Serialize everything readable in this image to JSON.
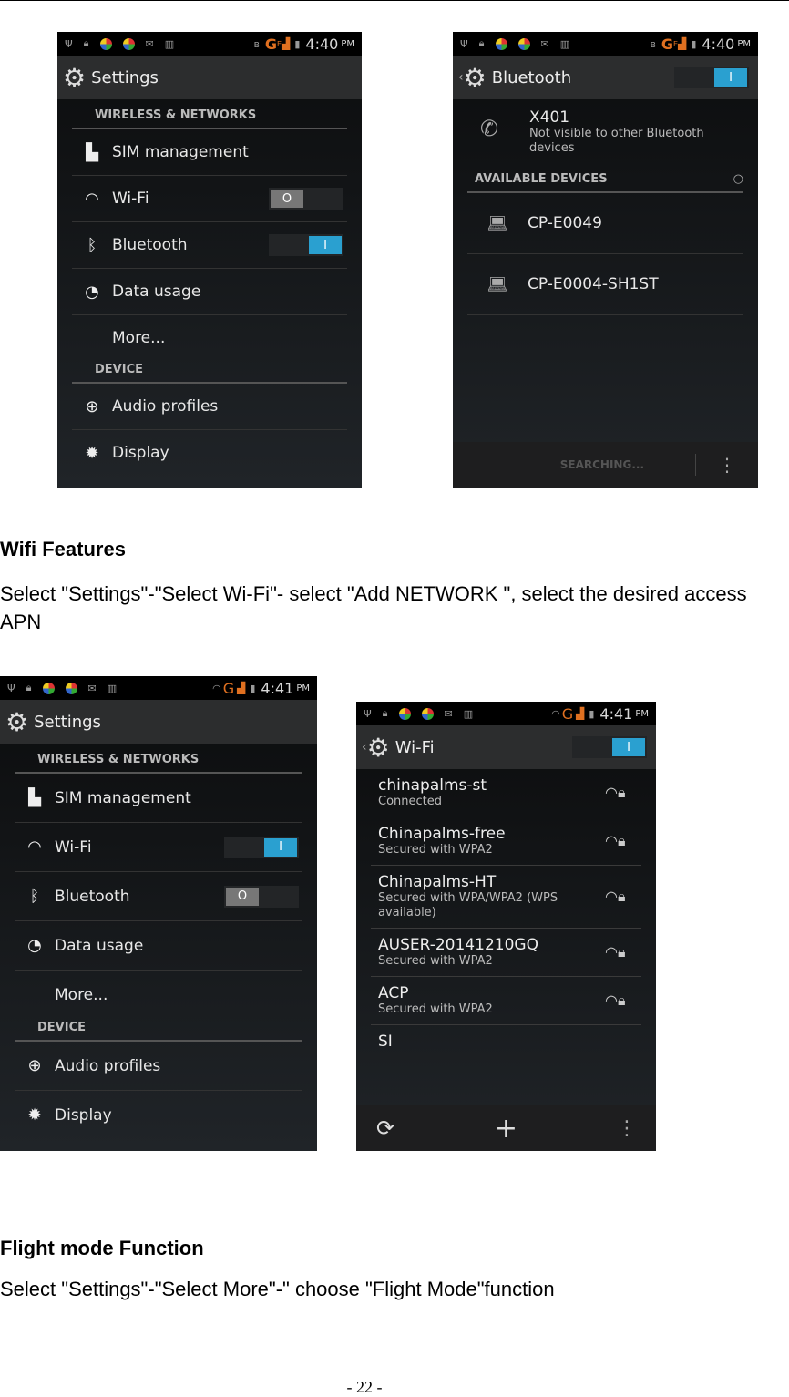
{
  "status_icons": [
    "usb-icon",
    "lock-icon",
    "app-swirl-icon",
    "app-swirl-icon",
    "mail-icon",
    "barcode-icon"
  ],
  "screen1": {
    "time": "4:40",
    "ampm": "PM",
    "network": "G",
    "network_sup": "E",
    "title": "Settings",
    "sections": [
      {
        "header": "WIRELESS & NETWORKS",
        "items": [
          {
            "label": "SIM management",
            "icon": "sim-icon"
          },
          {
            "label": "Wi-Fi",
            "icon": "wifi-icon",
            "toggle": "off"
          },
          {
            "label": "Bluetooth",
            "icon": "bluetooth-icon",
            "toggle": "on"
          },
          {
            "label": "Data usage",
            "icon": "data-usage-icon"
          },
          {
            "label": "More...",
            "icon": ""
          }
        ]
      },
      {
        "header": "DEVICE",
        "items": [
          {
            "label": "Audio profiles",
            "icon": "audio-profiles-icon"
          },
          {
            "label": "Display",
            "icon": "display-icon"
          }
        ]
      }
    ]
  },
  "screen2": {
    "time": "4:40",
    "ampm": "PM",
    "network": "G",
    "network_sup": "E",
    "title": "Bluetooth",
    "toggle": "on",
    "device_name": "X401",
    "device_status": "Not visible to other Bluetooth devices",
    "available_header": "AVAILABLE DEVICES",
    "devices": [
      "CP-E0049",
      "CP-E0004-SH1ST"
    ],
    "bottom_label": "SEARCHING..."
  },
  "wifi_section": {
    "heading": "Wifi Features",
    "body": "Select \"Settings\"-\"Select Wi-Fi\"- select \"Add NETWORK \", select the desired access APN"
  },
  "screen3": {
    "time": "4:41",
    "ampm": "PM",
    "network": "G",
    "title": "Settings",
    "sections": [
      {
        "header": "WIRELESS & NETWORKS",
        "items": [
          {
            "label": "SIM management"
          },
          {
            "label": "Wi-Fi",
            "toggle": "on"
          },
          {
            "label": "Bluetooth",
            "toggle": "off"
          },
          {
            "label": "Data usage"
          },
          {
            "label": "More..."
          }
        ]
      },
      {
        "header": "DEVICE",
        "items": [
          {
            "label": "Audio profiles"
          },
          {
            "label": "Display"
          }
        ]
      }
    ]
  },
  "screen4": {
    "time": "4:41",
    "ampm": "PM",
    "network": "G",
    "title": "Wi-Fi",
    "toggle": "on",
    "networks": [
      {
        "name": "chinapalms-st",
        "status": "Connected"
      },
      {
        "name": "Chinapalms-free",
        "status": "Secured with WPA2"
      },
      {
        "name": "Chinapalms-HT",
        "status": "Secured with WPA/WPA2 (WPS available)"
      },
      {
        "name": "AUSER-20141210GQ",
        "status": "Secured with WPA2"
      },
      {
        "name": "ACP",
        "status": "Secured with WPA2"
      },
      {
        "name": "SI",
        "status": ""
      }
    ]
  },
  "flight_section": {
    "heading": "Flight mode Function",
    "body": "Select \"Settings\"-\"Select More\"-\" choose \"Flight Mode\"function"
  },
  "page_number": "- 22 -",
  "colors": {
    "toggle_on": "#2aa0d0",
    "toggle_off": "#777777",
    "network_orange": "#e07020"
  }
}
